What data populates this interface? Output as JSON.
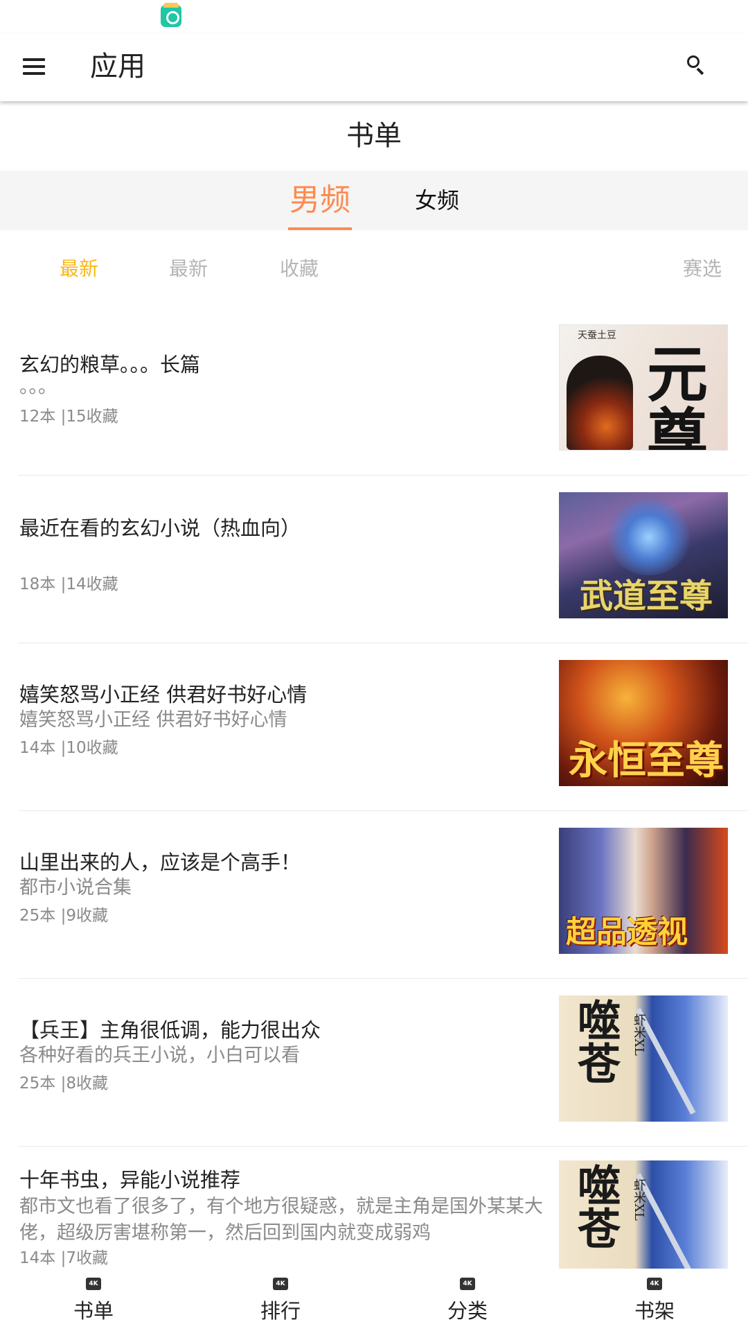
{
  "app_bar": {
    "title": "应用"
  },
  "section_title": "书单",
  "gender_tabs": {
    "selected": "男频",
    "items": [
      {
        "label": "男频"
      },
      {
        "label": "女频"
      }
    ]
  },
  "filters": {
    "items": [
      {
        "label": "最新",
        "active": true
      },
      {
        "label": "最新",
        "active": false
      },
      {
        "label": "收藏",
        "active": false
      }
    ],
    "filter_button": "赛选"
  },
  "booklists": [
    {
      "title": "玄幻的粮草。。。长篇",
      "description": "。。。",
      "meta": "12本 |15收藏",
      "cover_text": "元尊",
      "cover_tag": "天蚕土豆"
    },
    {
      "title": "最近在看的玄幻小说（热血向）",
      "description": "",
      "meta": "18本 |14收藏",
      "cover_text": "武道至尊"
    },
    {
      "title": "嬉笑怒骂小正经 供君好书好心情",
      "description": "嬉笑怒骂小正经 供君好书好心情",
      "meta": "14本 |10收藏",
      "cover_text": "永恒至尊"
    },
    {
      "title": "山里出来的人，应该是个高手！",
      "description": "都市小说合集",
      "meta": "25本 |9收藏",
      "cover_text": "超品透视"
    },
    {
      "title": "【兵王】主角很低调，能力很出众",
      "description": "各种好看的兵王小说，小白可以看",
      "meta": "25本 |8收藏",
      "cover_text": "噬苍",
      "cover_side": "虾米XL"
    },
    {
      "title": "十年书虫，异能小说推荐",
      "description": "都市文也看了很多了，有个地方很疑惑，就是主角是国外某某大佬，超级厉害堪称第一，然后回到国内就变成弱鸡",
      "meta": "14本 |7收藏",
      "cover_text": "噬苍",
      "cover_side": "虾米XL"
    }
  ],
  "bottom_nav": {
    "items": [
      {
        "label": "书单",
        "icon": "4K"
      },
      {
        "label": "排行",
        "icon": "4K"
      },
      {
        "label": "分类",
        "icon": "4K"
      },
      {
        "label": "书架",
        "icon": "4K"
      }
    ]
  },
  "colors": {
    "accent_orange": "#ff8a4c",
    "filter_active": "#f9b81a",
    "tab_bg": "#f5f5f5"
  }
}
